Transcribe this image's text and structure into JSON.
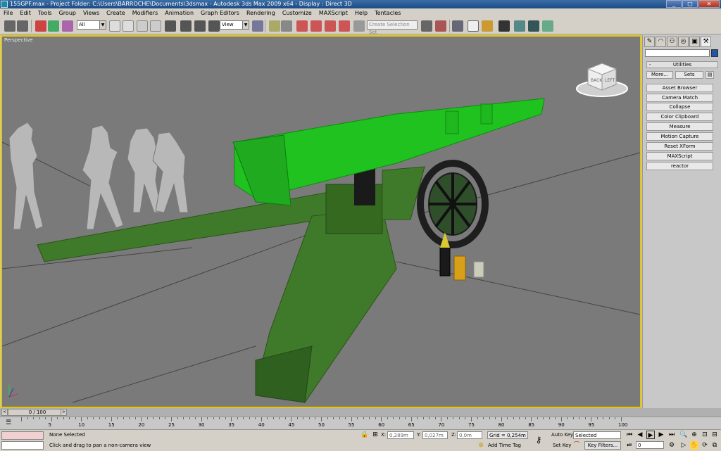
{
  "titlebar": {
    "text": "155GPF.max   -  Project Folder: C:\\Users\\BARROCHE\\Documents\\3dsmax   -  Autodesk 3ds Max  2009 x64   -  Display : Direct 3D",
    "minimize": "_",
    "maximize": "□",
    "close": "✕"
  },
  "menu": [
    "File",
    "Edit",
    "Tools",
    "Group",
    "Views",
    "Create",
    "Modifiers",
    "Animation",
    "Graph Editors",
    "Rendering",
    "Customize",
    "MAXScript",
    "Help",
    "Tentacles"
  ],
  "toolbar": {
    "selection_filter": "All",
    "reference_coord": "View",
    "named_selection_placeholder": "Create Selection Set",
    "dropdown_arrow": "▼"
  },
  "viewport": {
    "label": "Perspective",
    "viewcube_front": "BACK",
    "viewcube_side": "LEFT"
  },
  "command_panel": {
    "rollout_title": "Utilities",
    "rollout_toggle": "-",
    "more_label": "More...",
    "sets_label": "Sets",
    "utilities": [
      "Asset Browser",
      "Camera Match",
      "Collapse",
      "Color Clipboard",
      "Measure",
      "Motion Capture",
      "Reset XForm",
      "MAXScript",
      "reactor"
    ]
  },
  "timeline": {
    "slider_label": "0 / 100",
    "prev": "<",
    "next": ">",
    "ticks": [
      "5",
      "10",
      "15",
      "20",
      "25",
      "30",
      "35",
      "40",
      "45",
      "50",
      "55",
      "60",
      "65",
      "70",
      "75",
      "80",
      "85",
      "90",
      "95",
      "100"
    ]
  },
  "status": {
    "selection": "None Selected",
    "prompt": "Click and drag to pan a non-camera view",
    "x_label": "X:",
    "x_value": "0,289m",
    "y_label": "Y:",
    "y_value": "0,027m",
    "z_label": "Z:",
    "z_value": "0,0m",
    "grid": "Grid = 0,254m",
    "auto_key": "Auto Key",
    "set_key": "Set Key",
    "key_mode": "Selected",
    "key_filters": "Key Filters...",
    "add_time_tag": "Add Time Tag",
    "current_frame": "0"
  },
  "colors": {
    "viewport_border": "#e6c800",
    "viewport_bg": "#7a7a7a",
    "barrel": "#1fc21f",
    "carriage": "#3f7a2a"
  }
}
